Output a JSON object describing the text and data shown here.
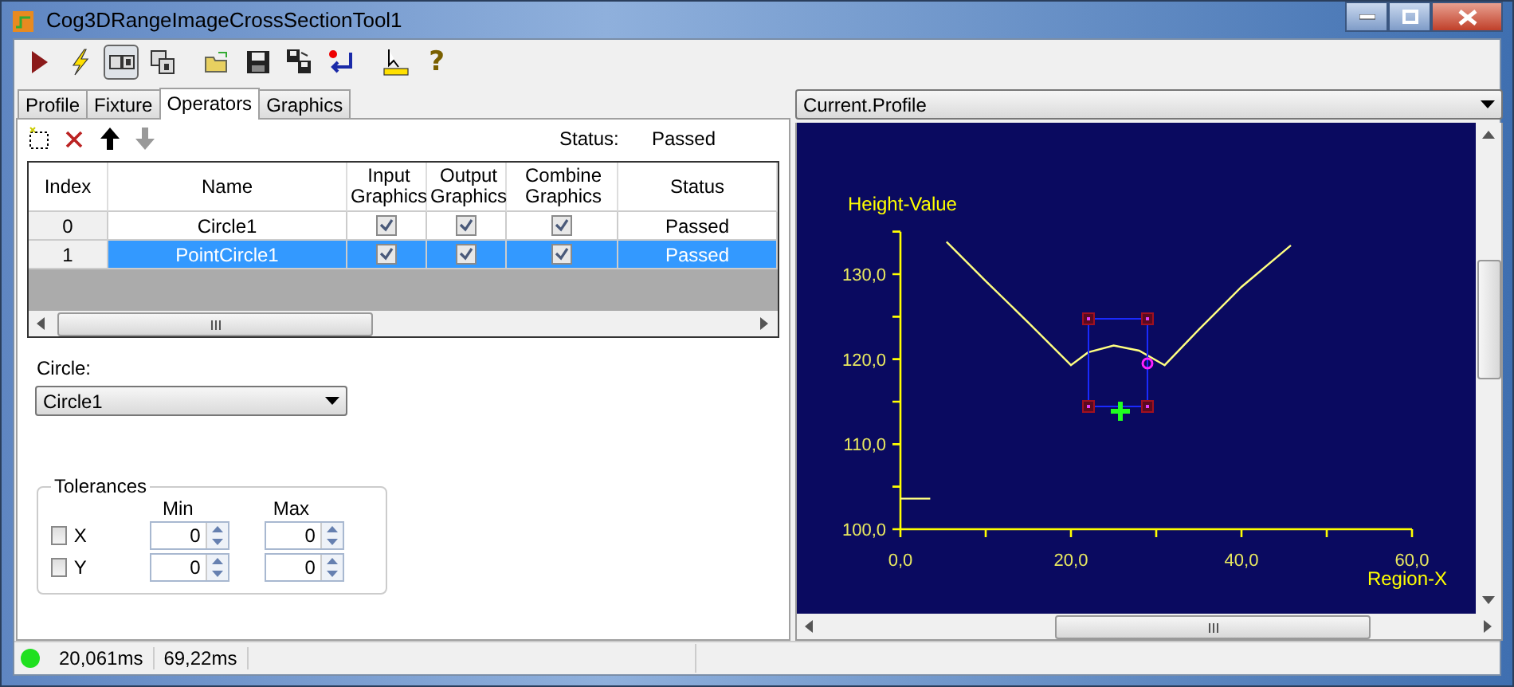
{
  "window": {
    "title": "Cog3DRangeImageCrossSectionTool1"
  },
  "toolbar": [
    {
      "kind": "run",
      "pressed": false
    },
    {
      "kind": "flash",
      "pressed": false
    },
    {
      "kind": "display",
      "pressed": true
    },
    {
      "kind": "float",
      "pressed": false
    },
    {
      "kind": "open",
      "pressed": false
    },
    {
      "kind": "save",
      "pressed": false
    },
    {
      "kind": "saveas",
      "pressed": false
    },
    {
      "kind": "reset",
      "pressed": false
    },
    {
      "kind": "edit",
      "pressed": false
    },
    {
      "kind": "help",
      "pressed": false,
      "label": "?"
    }
  ],
  "tabs": [
    {
      "label": "Profile",
      "selected": false
    },
    {
      "label": "Fixture",
      "selected": false
    },
    {
      "label": "Operators",
      "selected": true
    },
    {
      "label": "Graphics",
      "selected": false
    }
  ],
  "operators_toolbar": [
    {
      "kind": "add",
      "disabled": false
    },
    {
      "kind": "delete",
      "disabled": false
    },
    {
      "kind": "up",
      "disabled": false
    },
    {
      "kind": "down",
      "disabled": true
    }
  ],
  "status": {
    "label": "Status:",
    "value": "Passed"
  },
  "table": {
    "columns": [
      "Index",
      "Name",
      "Input Graphics",
      "Output Graphics",
      "Combine Graphics",
      "Status"
    ],
    "rows": [
      {
        "index": "0",
        "name": "Circle1",
        "input_graphics": true,
        "output_graphics": true,
        "combine_graphics": true,
        "status": "Passed",
        "selected": false
      },
      {
        "index": "1",
        "name": "PointCircle1",
        "input_graphics": true,
        "output_graphics": true,
        "combine_graphics": true,
        "status": "Passed",
        "selected": true
      }
    ]
  },
  "circle": {
    "label": "Circle:",
    "value": "Circle1"
  },
  "tolerances": {
    "title": "Tolerances",
    "min_label": "Min",
    "max_label": "Max",
    "rows": [
      {
        "label": "X",
        "checked": false,
        "min": "0",
        "max": "0"
      },
      {
        "label": "Y",
        "checked": false,
        "min": "0",
        "max": "0"
      }
    ]
  },
  "view": {
    "selector": "Current.Profile",
    "chart_data": {
      "type": "line",
      "xlabel": "Region-X",
      "ylabel": "Height-Value",
      "x": [
        0,
        3.5,
        4.5,
        5.4,
        10,
        15,
        20,
        22,
        25,
        28,
        31,
        35,
        40,
        45.8
      ],
      "series": [
        {
          "color": "#ffff80",
          "values": [
            103.6,
            103.6,
            null,
            133.8,
            129.2,
            124.3,
            119.3,
            120.8,
            121.6,
            121.0,
            119.3,
            123.5,
            128.5,
            133.4
          ]
        }
      ],
      "xlim": [
        0,
        60
      ],
      "ylim": [
        100,
        135
      ],
      "xticks": [
        {
          "value": 0,
          "label": "0,0"
        },
        {
          "value": 20,
          "label": "20,0"
        },
        {
          "value": 40,
          "label": "40,0"
        },
        {
          "value": 60,
          "label": "60,0"
        }
      ],
      "yticks": [
        {
          "value": 100,
          "label": "100,0"
        },
        {
          "value": 110,
          "label": "110,0"
        },
        {
          "value": 120,
          "label": "120,0"
        },
        {
          "value": 130,
          "label": "130,0"
        }
      ]
    }
  },
  "status_bar": {
    "ok": true,
    "times": [
      "20,061ms",
      "69,22ms"
    ]
  }
}
